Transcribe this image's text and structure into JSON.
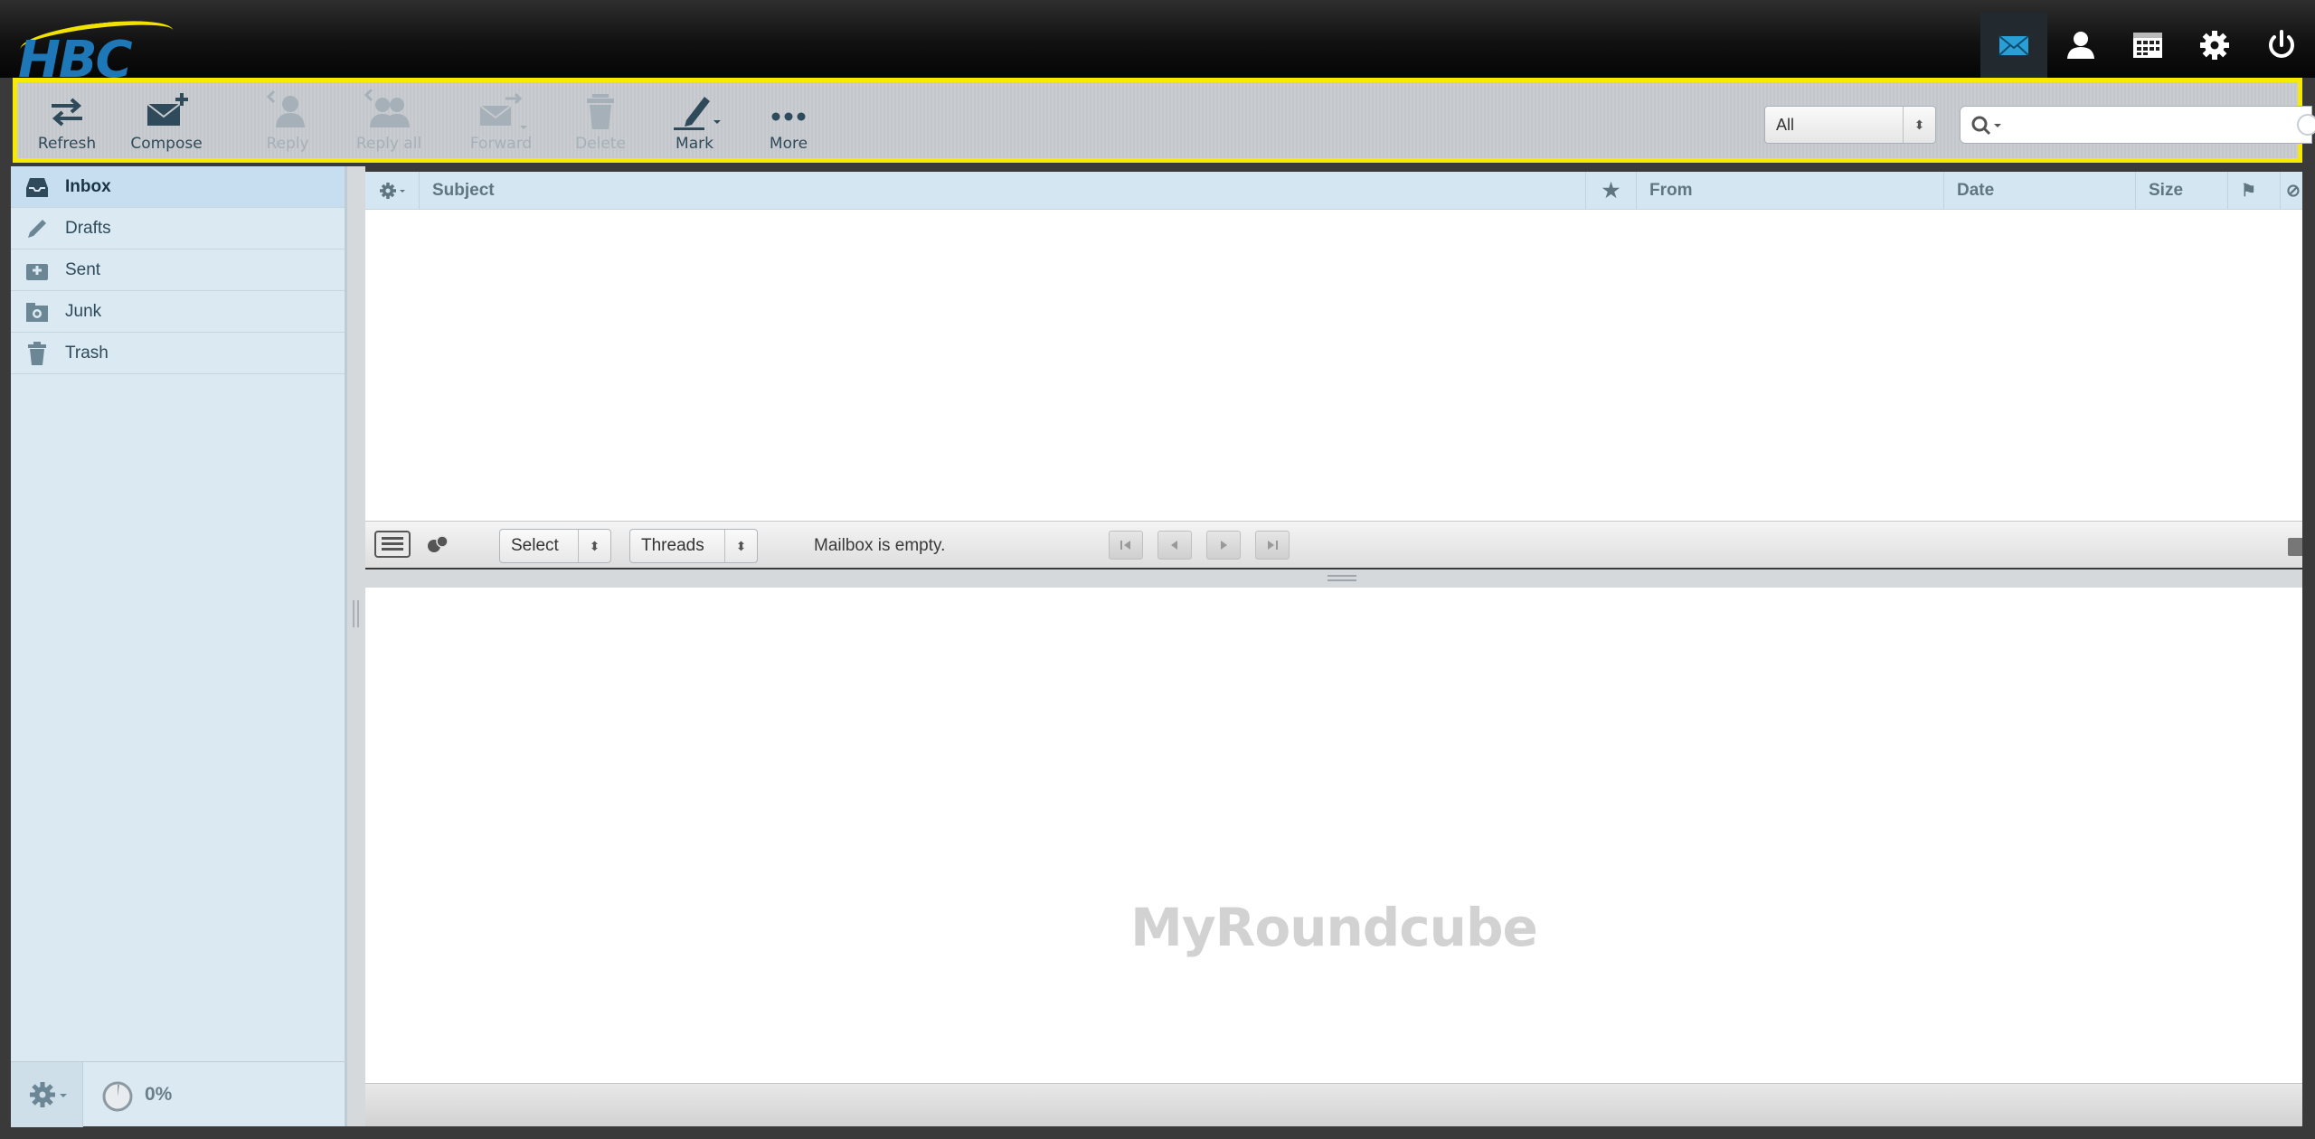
{
  "brand": {
    "logo_text": "HBC"
  },
  "topnav": [
    "mail-icon",
    "contacts-icon",
    "calendar-icon",
    "settings-icon",
    "logout-icon"
  ],
  "toolbar": {
    "refresh": "Refresh",
    "compose": "Compose",
    "reply": "Reply",
    "reply_all": "Reply all",
    "forward": "Forward",
    "delete": "Delete",
    "mark": "Mark",
    "more": "More",
    "filter_value": "All",
    "search_value": ""
  },
  "folders": [
    {
      "label": "Inbox",
      "icon": "inbox-icon",
      "selected": true
    },
    {
      "label": "Drafts",
      "icon": "pencil-icon",
      "selected": false
    },
    {
      "label": "Sent",
      "icon": "sent-icon",
      "selected": false
    },
    {
      "label": "Junk",
      "icon": "junk-icon",
      "selected": false
    },
    {
      "label": "Trash",
      "icon": "trash-icon",
      "selected": false
    }
  ],
  "quota": {
    "text": "0%"
  },
  "message_list": {
    "columns": {
      "subject": "Subject",
      "from": "From",
      "date": "Date",
      "size": "Size"
    },
    "select_label": "Select",
    "threads_label": "Threads",
    "status": "Mailbox is empty."
  },
  "preview": {
    "watermark": "MyRoundcube"
  },
  "colors": {
    "accent": "#2a9fd6",
    "highlight": "#f7ea00",
    "sidebar": "#dbe9f2"
  }
}
